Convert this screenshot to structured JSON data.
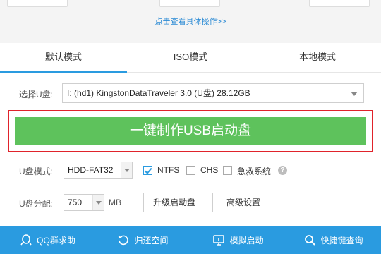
{
  "top": {
    "link_text": "点击查看具体操作>>"
  },
  "tabs": [
    {
      "label": "默认模式",
      "active": true
    },
    {
      "label": "ISO模式",
      "active": false
    },
    {
      "label": "本地模式",
      "active": false
    }
  ],
  "device": {
    "label": "选择U盘:",
    "value": "I: (hd1) KingstonDataTraveler 3.0 (U盘) 28.12GB"
  },
  "make_button": {
    "label": "一键制作USB启动盘"
  },
  "mode": {
    "label": "U盘模式:",
    "value": "HDD-FAT32",
    "options": [
      {
        "label": "NTFS",
        "checked": true
      },
      {
        "label": "CHS",
        "checked": false
      },
      {
        "label": "急救系统",
        "checked": false
      }
    ],
    "help": "?"
  },
  "partition": {
    "label": "U盘分配:",
    "value": "750",
    "unit": "MB",
    "upgrade_button": "升级启动盘",
    "advanced_button": "高级设置"
  },
  "bottom_bar": {
    "accent": "#2a9be0",
    "items": [
      {
        "label": "QQ群求助",
        "icon": "qq-icon"
      },
      {
        "label": "归还空间",
        "icon": "restore-icon"
      },
      {
        "label": "模拟启动",
        "icon": "monitor-icon"
      },
      {
        "label": "快捷键查询",
        "icon": "search-icon"
      }
    ]
  }
}
